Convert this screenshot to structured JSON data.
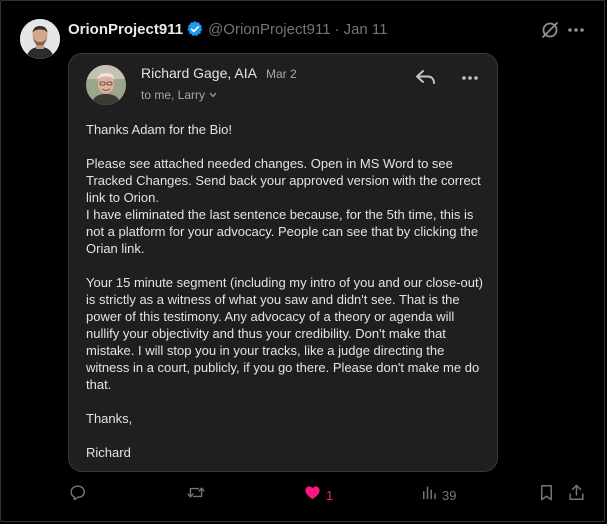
{
  "tweet": {
    "display_name": "OrionProject911",
    "handle": "@OrionProject911",
    "separator": "·",
    "date": "Jan 11",
    "verified": true
  },
  "email": {
    "sender_name": "Richard Gage, AIA",
    "sent_date": "Mar 2",
    "recipients": "to me, Larry",
    "body": [
      "Thanks Adam for the Bio!",
      "Please see attached needed changes.  Open in MS Word to see Tracked Changes. Send back your approved version with the correct link to Orion.\nI have eliminated the last sentence because, for the 5th time, this is not a platform for your advocacy.  People can see that by clicking the Orian link.",
      "Your 15 minute segment (including my intro of you and our close-out) is strictly as a witness of what you saw and didn't see.  That is the power of this testimony.  Any advocacy of a theory or agenda will nullify your objectivity and thus your credibility.  Don't make that mistake. I will stop you in your tracks, like a judge directing the witness in a court, publicly, if you go there. Please don't make me do that.",
      "Thanks,",
      "Richard"
    ]
  },
  "actions": {
    "reply_count": "",
    "repost_count": "",
    "like_count": "1",
    "views_count": "39"
  },
  "colors": {
    "background": "#000000",
    "card_background": "#1f1f1f",
    "verified_blue": "#1d9bf0",
    "like_pink": "#f91880",
    "muted_text": "#71767b"
  },
  "icons": [
    "verified-badge-icon",
    "grok-icon",
    "more-icon",
    "reply-arrow-icon",
    "chevron-down-icon",
    "reply-icon",
    "repost-icon",
    "heart-icon",
    "views-icon",
    "bookmark-icon",
    "share-icon"
  ]
}
